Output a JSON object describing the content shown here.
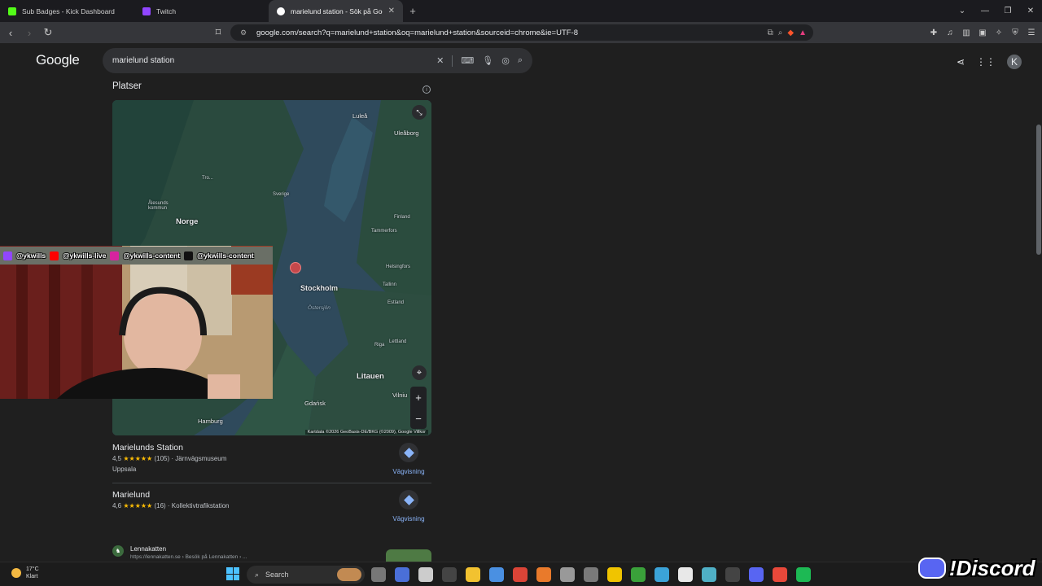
{
  "browser": {
    "tabs": [
      {
        "title": "Sub Badges - Kick Dashboard",
        "color": "#53fc18"
      },
      {
        "title": "Twitch",
        "color": "#9146ff"
      },
      {
        "title": "marielund station - Sök på Goog",
        "color": "#ffffff",
        "active": true
      }
    ],
    "url": "google.com/search?q=marielund+station&oq=marielund+station&sourceid=chrome&ie=UTF-8"
  },
  "google": {
    "logo": "Google",
    "query": "marielund station",
    "avatar_letter": "K",
    "section_title": "Platser"
  },
  "map": {
    "labels": {
      "lulea": "Luleå",
      "uleaborg": "Uleåborg",
      "tro": "Tro...",
      "sverige": "Sverige",
      "alesund": "Ålesunds kommun",
      "norge": "Norge",
      "finland": "Finland",
      "tammerfors": "Tammerfors",
      "helsingfors": "Helsingfors",
      "stockholm": "Stockholm",
      "tallinn": "Tallinn",
      "ostersjon": "Östersjön",
      "estland": "Estland",
      "lettland": "Lettland",
      "riga": "Riga",
      "litauen": "Litauen",
      "vilnius": "Vilniu",
      "gdansk": "Gdańsk",
      "hamburg": "Hamburg"
    },
    "attribution": "Kartdata ©2026 GeoBasis-DE/BKG (©2009), Google",
    "terms": "Villkor"
  },
  "places": [
    {
      "name": "Marielunds Station",
      "rating": "4,5",
      "stars": "★★★★★",
      "count": "(105)",
      "type": "Järnvägsmuseum",
      "location": "Uppsala",
      "directions": "Vägvisning"
    },
    {
      "name": "Marielund",
      "rating": "4,6",
      "stars": "★★★★★",
      "count": "(16)",
      "type": "Kollektivtrafikstation",
      "directions": "Vägvisning"
    }
  ],
  "result": {
    "title": "Lennakatten",
    "sub": "https://lennakatten.se › Besök på Lennakatten › ..."
  },
  "overlay": {
    "handles": [
      "@ykwills",
      "@ykwills-live",
      "@ykwills-content",
      "@ykwills-content"
    ],
    "badge_colors": [
      "#9146ff",
      "#ff0000",
      "#d6249f",
      "#111111"
    ]
  },
  "taskbar": {
    "temp": "17°C",
    "condition": "Klart",
    "search_label": "Search",
    "app_colors": [
      "#777777",
      "#4a6fd8",
      "#cccccc",
      "#444444",
      "#f2c230",
      "#4a90e2",
      "#db4437",
      "#e97a2b",
      "#999999",
      "#7a7a7a",
      "#f0c400",
      "#3aa13a",
      "#3ba3d8",
      "#e8e8e8",
      "#4fb0c6",
      "#444444",
      "#5865f2",
      "#e8483a",
      "#1db954"
    ]
  },
  "stream": {
    "discord_text": "!Discord"
  }
}
